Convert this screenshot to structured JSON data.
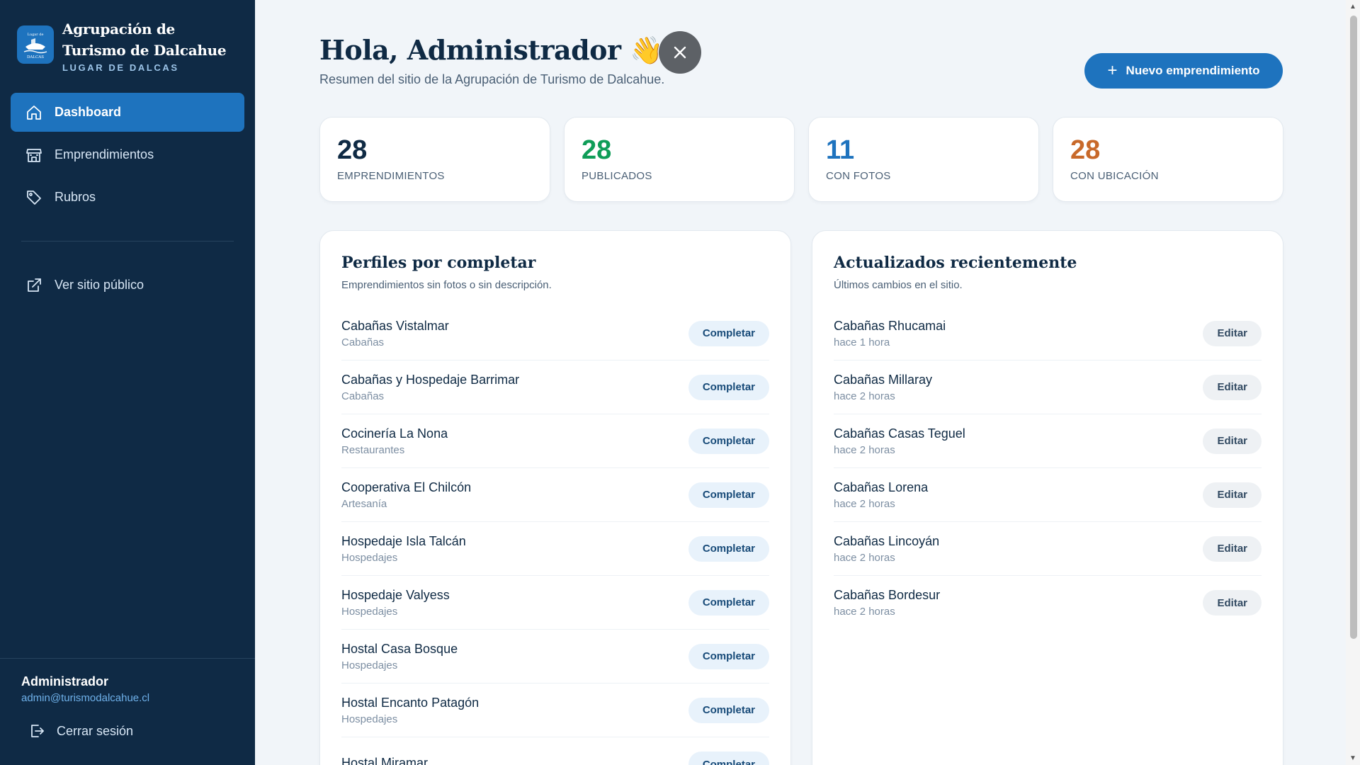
{
  "brand": {
    "title": "Agrupación de Turismo de Dalcahue",
    "subtitle": "LUGAR DE DALCAS",
    "logo_text_top": "Lugar de",
    "logo_text_bottom": "DALCAS"
  },
  "sidebar": {
    "items": [
      {
        "label": "Dashboard",
        "icon": "home-icon",
        "active": true
      },
      {
        "label": "Emprendimientos",
        "icon": "store-icon",
        "active": false
      },
      {
        "label": "Rubros",
        "icon": "tag-icon",
        "active": false
      }
    ],
    "public_link": {
      "label": "Ver sitio público",
      "icon": "external-link-icon"
    }
  },
  "user": {
    "name": "Administrador",
    "email": "admin@turismodalcahue.cl",
    "logout_label": "Cerrar sesión"
  },
  "header": {
    "greeting": "Hola, Administrador 👋",
    "subtitle": "Resumen del sitio de la Agrupación de Turismo de Dalcahue.",
    "new_button_label": "Nuevo emprendimiento"
  },
  "stats": [
    {
      "value": "28",
      "label": "EMPRENDIMIENTOS",
      "color": "#0f2a44"
    },
    {
      "value": "28",
      "label": "PUBLICADOS",
      "color": "#0f9d58"
    },
    {
      "value": "11",
      "label": "CON FOTOS",
      "color": "#1e73be"
    },
    {
      "value": "28",
      "label": "CON UBICACIÓN",
      "color": "#c8692a"
    }
  ],
  "incomplete": {
    "title": "Perfiles por completar",
    "subtitle": "Emprendimientos sin fotos o sin descripción.",
    "action_label": "Completar",
    "rows": [
      {
        "name": "Cabañas Vistalmar",
        "category": "Cabañas"
      },
      {
        "name": "Cabañas y Hospedaje Barrimar",
        "category": "Cabañas"
      },
      {
        "name": "Cocinería La Nona",
        "category": "Restaurantes"
      },
      {
        "name": "Cooperativa El Chilcón",
        "category": "Artesanía"
      },
      {
        "name": "Hospedaje Isla Talcán",
        "category": "Hospedajes"
      },
      {
        "name": "Hospedaje Valyess",
        "category": "Hospedajes"
      },
      {
        "name": "Hostal Casa Bosque",
        "category": "Hospedajes"
      },
      {
        "name": "Hostal Encanto Patagón",
        "category": "Hospedajes"
      },
      {
        "name": "Hostal Miramar",
        "category": ""
      }
    ]
  },
  "recent": {
    "title": "Actualizados recientemente",
    "subtitle": "Últimos cambios en el sitio.",
    "action_label": "Editar",
    "rows": [
      {
        "name": "Cabañas Rhucamai",
        "time": "hace 1 hora"
      },
      {
        "name": "Cabañas Millaray",
        "time": "hace 2 horas"
      },
      {
        "name": "Cabañas Casas Teguel",
        "time": "hace 2 horas"
      },
      {
        "name": "Cabañas Lorena",
        "time": "hace 2 horas"
      },
      {
        "name": "Cabañas Lincoyán",
        "time": "hace 2 horas"
      },
      {
        "name": "Cabañas Bordesur",
        "time": "hace 2 horas"
      }
    ]
  },
  "colors": {
    "sidebar_bg": "#0f2a45",
    "accent": "#1e73be"
  }
}
